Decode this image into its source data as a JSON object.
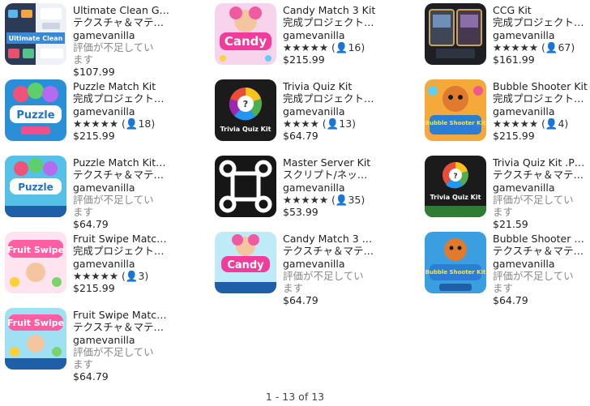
{
  "products": [
    {
      "title": "Ultimate Clean G…",
      "category": "テクスチャ＆マテ…",
      "publisher": "gamevanilla",
      "rating_text": "",
      "no_rating_text": "評価が不足しています",
      "price": "$107.99",
      "thumb_icon": "ultimate-clean-thumbnail",
      "thumb_text": "Ultimate Clean"
    },
    {
      "title": "Candy Match 3 Kit",
      "category": "完成プロジェクト…",
      "publisher": "gamevanilla",
      "rating_text": "★★★★★ (👤16)",
      "no_rating_text": "",
      "price": "$215.99",
      "thumb_icon": "candy-match-thumbnail",
      "thumb_text": "Candy"
    },
    {
      "title": "CCG Kit",
      "category": "完成プロジェクト…",
      "publisher": "gamevanilla",
      "rating_text": "★★★★★ (👤67)",
      "no_rating_text": "",
      "price": "$161.99",
      "thumb_icon": "ccg-kit-thumbnail",
      "thumb_text": ""
    },
    {
      "title": "Puzzle Match Kit",
      "category": "完成プロジェクト…",
      "publisher": "gamevanilla",
      "rating_text": "★★★★★ (👤18)",
      "no_rating_text": "",
      "price": "$215.99",
      "thumb_icon": "puzzle-match-thumbnail",
      "thumb_text": "Puzzle"
    },
    {
      "title": "Trivia Quiz Kit",
      "category": "完成プロジェクト…",
      "publisher": "gamevanilla",
      "rating_text": "★★★★ (👤13)",
      "no_rating_text": "",
      "price": "$64.79",
      "thumb_icon": "trivia-quiz-thumbnail",
      "thumb_text": "Trivia Quiz Kit"
    },
    {
      "title": "Bubble Shooter Kit",
      "category": "完成プロジェクト…",
      "publisher": "gamevanilla",
      "rating_text": "★★★★★ (👤4)",
      "no_rating_text": "",
      "price": "$215.99",
      "thumb_icon": "bubble-shooter-thumbnail",
      "thumb_text": "Bubble Shooter Kit"
    },
    {
      "title": "Puzzle Match Kit…",
      "category": "テクスチャ＆マテ…",
      "publisher": "gamevanilla",
      "rating_text": "",
      "no_rating_text": "評価が不足しています",
      "price": "$64.79",
      "thumb_icon": "puzzle-match-psd-thumbnail",
      "thumb_text": "Puzzle"
    },
    {
      "title": "Master Server Kit",
      "category": "スクリプト/ネッ…",
      "publisher": "gamevanilla",
      "rating_text": "★★★★★ (👤35)",
      "no_rating_text": "",
      "price": "$53.99",
      "thumb_icon": "master-server-thumbnail",
      "thumb_text": ""
    },
    {
      "title": "Trivia Quiz Kit .P…",
      "category": "テクスチャ＆マテ…",
      "publisher": "gamevanilla",
      "rating_text": "",
      "no_rating_text": "評価が不足しています",
      "price": "$21.59",
      "thumb_icon": "trivia-quiz-psd-thumbnail",
      "thumb_text": "Trivia Quiz Kit"
    },
    {
      "title": "Fruit Swipe Matc…",
      "category": "完成プロジェクト…",
      "publisher": "gamevanilla",
      "rating_text": "★★★★★ (👤3)",
      "no_rating_text": "",
      "price": "$215.99",
      "thumb_icon": "fruit-swipe-thumbnail",
      "thumb_text": "Fruit Swipe"
    },
    {
      "title": "Candy Match 3 …",
      "category": "テクスチャ＆マテ…",
      "publisher": "gamevanilla",
      "rating_text": "",
      "no_rating_text": "評価が不足しています",
      "price": "$64.79",
      "thumb_icon": "candy-match-psd-thumbnail",
      "thumb_text": "Candy"
    },
    {
      "title": "Bubble Shooter …",
      "category": "テクスチャ＆マテ…",
      "publisher": "gamevanilla",
      "rating_text": "",
      "no_rating_text": "評価が不足しています",
      "price": "$64.79",
      "thumb_icon": "bubble-shooter-psd-thumbnail",
      "thumb_text": "Bubble Shooter Kit"
    },
    {
      "title": "Fruit Swipe Matc…",
      "category": "テクスチャ＆マテ…",
      "publisher": "gamevanilla",
      "rating_text": "",
      "no_rating_text": "評価が不足しています",
      "price": "$64.79",
      "thumb_icon": "fruit-swipe-psd-thumbnail",
      "thumb_text": "Fruit Swipe"
    }
  ],
  "pagination": {
    "label": "1 - 13 of 13"
  }
}
